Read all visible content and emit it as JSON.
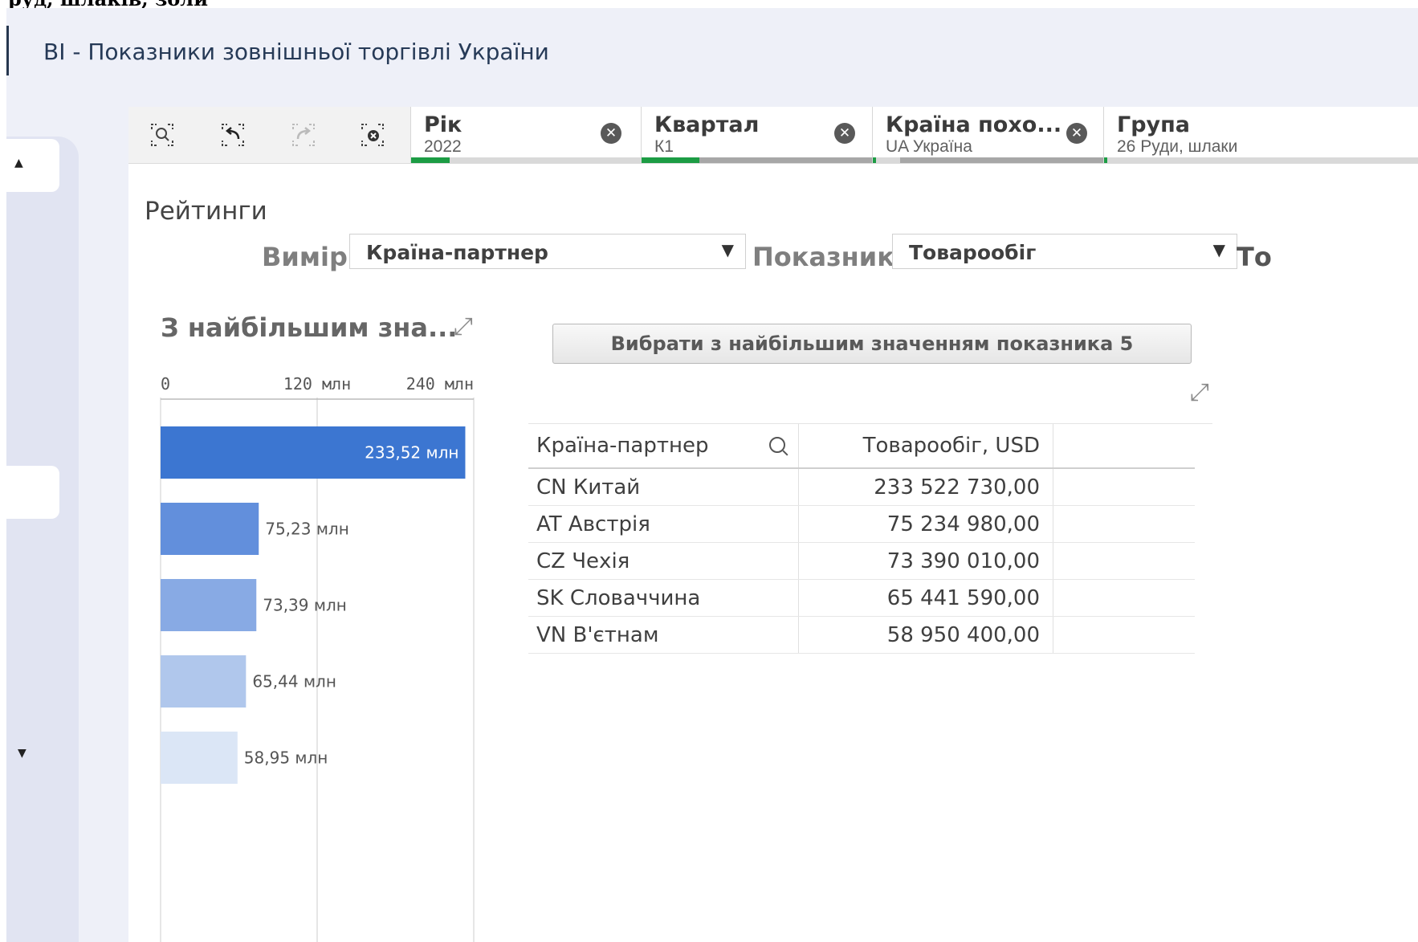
{
  "top_cut_text": "руд, шлаків, золи",
  "app": {
    "title": "BI - Показники зовнішньої торгівлі України"
  },
  "nav": {
    "up_caret": "▲",
    "down_caret": "▼"
  },
  "toolbar": {
    "tools": [
      "smart-search-icon",
      "step-back-icon",
      "step-forward-icon",
      "clear-selections-icon"
    ],
    "filters": [
      {
        "title": "Рік",
        "value": "2022"
      },
      {
        "title": "Квартал",
        "value": "К1"
      },
      {
        "title": "Країна похо...",
        "value": "UA Україна"
      },
      {
        "title": "Група",
        "value": "26 Руди, шлаки"
      }
    ],
    "clear_glyph": "✕"
  },
  "section": {
    "title": "Рейтинги",
    "dimension_label": "Вимір",
    "dimension_value": "Країна-партнер",
    "measure_label": "Показник",
    "measure_value": "Товарообіг",
    "cut_label": "То"
  },
  "chart": {
    "title": "З найбільшим зна...",
    "expand_glyph": "⤢"
  },
  "chart_data": {
    "type": "bar",
    "orientation": "horizontal",
    "title": "З найбільшим зна...",
    "categories": [
      "CN Китай",
      "AT Австрія",
      "CZ Чехія",
      "SK Словаччина",
      "VN В'єтнам"
    ],
    "values": [
      233.52,
      75.23,
      73.39,
      65.44,
      58.95
    ],
    "value_labels": [
      "233,52 млн",
      "75,23 млн",
      "73,39 млн",
      "65,44 млн",
      "58,95 млн"
    ],
    "unit": "млн",
    "axis_ticks": [
      "0",
      "120 млн",
      "240 млн"
    ],
    "axis_tick_values": [
      0,
      120,
      240
    ],
    "xlim": [
      0,
      240
    ],
    "grid": true,
    "colors": [
      "#3c76d1",
      "#628fdc",
      "#88aae4",
      "#b0c7ec",
      "#dbe6f6"
    ]
  },
  "button": {
    "label": "Вибрати з найбільшим значенням показника 5"
  },
  "table": {
    "headers": [
      "Країна-партнер",
      "Товарообіг, USD"
    ],
    "rows": [
      [
        "CN Китай",
        "233 522 730,00"
      ],
      [
        "AT Австрія",
        "75 234 980,00"
      ],
      [
        "CZ Чехія",
        "73 390 010,00"
      ],
      [
        "SK Словаччина",
        "65 441 590,00"
      ],
      [
        "VN В'єтнам",
        "58 950 400,00"
      ]
    ]
  }
}
